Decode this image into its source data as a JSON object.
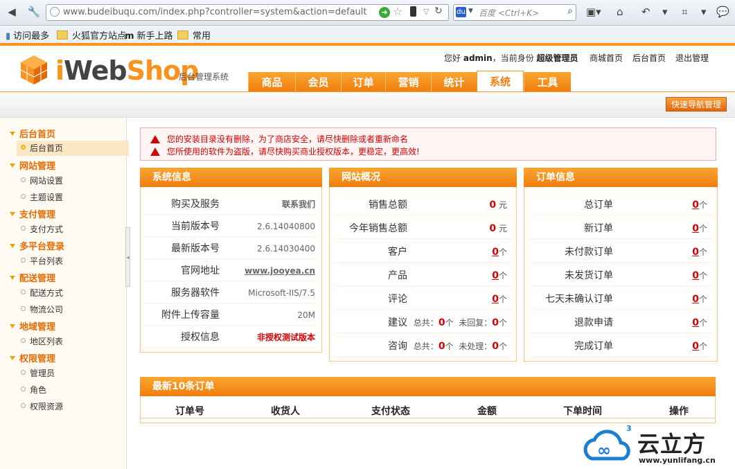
{
  "browser": {
    "url": "www.budeibuqu.com/index.php?controller=system&action=default",
    "search_placeholder": "百度 <Ctrl+K>",
    "bookmarks": [
      "访问最多",
      "火狐官方站点",
      "新手上路",
      "常用"
    ]
  },
  "header": {
    "logo_i": "i",
    "logo_web": "Web",
    "logo_shop": "Shop",
    "logo_sub": "后台管理系统",
    "greeting": "您好",
    "user": "admin",
    "role_prefix": "，当前身份",
    "role": "超级管理员",
    "links": [
      "商城首页",
      "后台首页",
      "退出管理"
    ],
    "menu": [
      "商品",
      "会员",
      "订单",
      "营销",
      "统计",
      "系统",
      "工具"
    ],
    "active_menu": "系统",
    "quick_nav": "快速导航管理"
  },
  "sidebar": {
    "groups": [
      {
        "title": "后台首页",
        "items": [
          "后台首页"
        ]
      },
      {
        "title": "网站管理",
        "items": [
          "网站设置",
          "主题设置"
        ]
      },
      {
        "title": "支付管理",
        "items": [
          "支付方式"
        ]
      },
      {
        "title": "多平台登录",
        "items": [
          "平台列表"
        ]
      },
      {
        "title": "配送管理",
        "items": [
          "配送方式",
          "物流公司"
        ]
      },
      {
        "title": "地域管理",
        "items": [
          "地区列表"
        ]
      },
      {
        "title": "权限管理",
        "items": [
          "管理员",
          "角色",
          "权限资源"
        ]
      }
    ]
  },
  "alerts": [
    "您的安装目录没有删除，为了商店安全，请尽快删除或者重新命名",
    "您所使用的软件为盗版，请尽快购买商业授权版本，更稳定，更高效!"
  ],
  "system_info": {
    "title": "系统信息",
    "rows": [
      {
        "k": "购买及服务",
        "v": "联系我们"
      },
      {
        "k": "当前版本号",
        "v": "2.6.14040800"
      },
      {
        "k": "最新版本号",
        "v": "2.6.14030400"
      },
      {
        "k": "官网地址",
        "v": "www.jooyea.cn"
      },
      {
        "k": "服务器软件",
        "v": "Microsoft-IIS/7.5"
      },
      {
        "k": "附件上传容量",
        "v": "20M"
      },
      {
        "k": "授权信息",
        "v": "非授权测试版本"
      }
    ]
  },
  "site_overview": {
    "title": "网站概况",
    "rows": [
      {
        "k": "销售总额",
        "v": "0",
        "unit": "元"
      },
      {
        "k": "今年销售总额",
        "v": "0",
        "unit": "元"
      },
      {
        "k": "客户",
        "v": "0",
        "unit": "个"
      },
      {
        "k": "产品",
        "v": "0",
        "unit": "个"
      },
      {
        "k": "评论",
        "v": "0",
        "unit": "个"
      },
      {
        "k": "建议",
        "total_label": "总共：",
        "total": "0",
        "unit": "个",
        "pending_label": "未回复：",
        "pending": "0"
      },
      {
        "k": "咨询",
        "total_label": "总共：",
        "total": "0",
        "unit": "个",
        "pending_label": "未处理：",
        "pending": "0"
      }
    ]
  },
  "order_info": {
    "title": "订单信息",
    "rows": [
      {
        "k": "总订单",
        "v": "0",
        "unit": "个"
      },
      {
        "k": "新订单",
        "v": "0",
        "unit": "个"
      },
      {
        "k": "未付款订单",
        "v": "0",
        "unit": "个"
      },
      {
        "k": "未发货订单",
        "v": "0",
        "unit": "个"
      },
      {
        "k": "七天未确认订单",
        "v": "0",
        "unit": "个"
      },
      {
        "k": "退款申请",
        "v": "0",
        "unit": "个"
      },
      {
        "k": "完成订单",
        "v": "0",
        "unit": "个"
      }
    ]
  },
  "latest_orders": {
    "title": "最新10条订单",
    "columns": [
      "订单号",
      "收货人",
      "支付状态",
      "金额",
      "下单时间",
      "操作"
    ]
  },
  "watermark": {
    "name": "云立方",
    "url": "www.yunlifang.cn",
    "sup": "3"
  },
  "colors": {
    "accent": "#f7931e",
    "alert": "#d10000"
  }
}
